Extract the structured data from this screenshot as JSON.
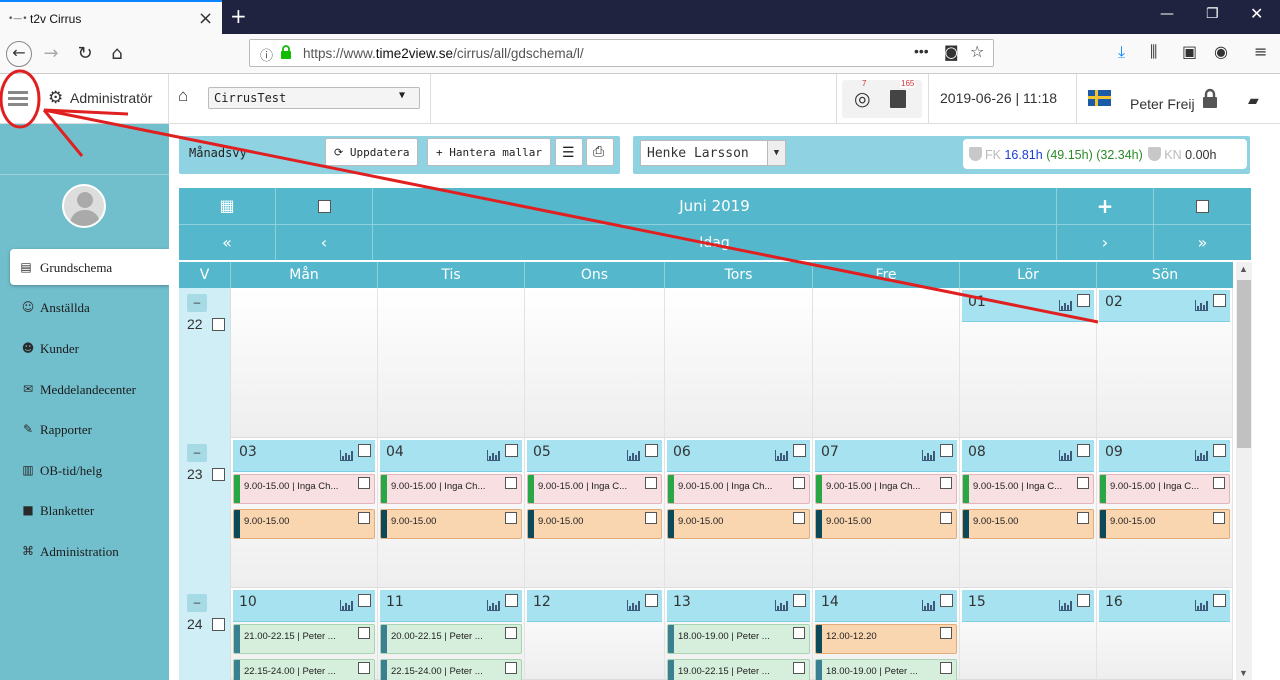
{
  "browser": {
    "tab_title": "t2v Cirrus",
    "favicon_text": "•—•",
    "url_host": "https://www.",
    "url_domain": "time2view.se",
    "url_path": "/cirrus/all/gdschema/l/"
  },
  "header": {
    "role_label": "Administratör",
    "customer_select": "CirrusTest",
    "badge_left": "7",
    "badge_right": "165",
    "datetime": "2019-06-26 | 11:18",
    "user_name": "Peter Freij"
  },
  "sidebar": {
    "items": [
      {
        "label": "Grundschema",
        "icon": "calendar-icon",
        "glyph": "▤"
      },
      {
        "label": "Anställda",
        "icon": "users-icon",
        "glyph": "☺"
      },
      {
        "label": "Kunder",
        "icon": "user-icon",
        "glyph": "☻"
      },
      {
        "label": "Meddelandecenter",
        "icon": "envelope-icon",
        "glyph": "✉"
      },
      {
        "label": "Rapporter",
        "icon": "pencil-icon",
        "glyph": "✎"
      },
      {
        "label": "OB-tid/helg",
        "icon": "chart-icon",
        "glyph": "▥"
      },
      {
        "label": "Blanketter",
        "icon": "file-icon",
        "glyph": "■"
      },
      {
        "label": "Administration",
        "icon": "key-icon",
        "glyph": "⌘"
      }
    ]
  },
  "toolbar": {
    "view_label": "Månadsvy",
    "refresh_label": "Uppdatera",
    "templates_label": "Hantera mallar"
  },
  "employee": {
    "selected": "Henke Larsson"
  },
  "hours": {
    "fk_label": "FK",
    "fk_value": "16.81h",
    "fk_extra1": "(49.15h)",
    "fk_extra2": "(32.34h)",
    "kn_label": "KN",
    "kn_value": "0.00h"
  },
  "calendar": {
    "month_title": "Juni 2019",
    "today_label": "Idag",
    "week_col": "V",
    "days": [
      "Mån",
      "Tis",
      "Ons",
      "Tors",
      "Fre",
      "Lör",
      "Sön"
    ],
    "weeks": [
      {
        "week": "22",
        "dates": [
          "",
          "",
          "",
          "",
          "",
          "01",
          "02"
        ]
      },
      {
        "week": "23",
        "dates": [
          "03",
          "04",
          "05",
          "06",
          "07",
          "08",
          "09"
        ]
      },
      {
        "week": "24",
        "dates": [
          "10",
          "11",
          "12",
          "13",
          "14",
          "15",
          "16"
        ]
      }
    ],
    "events_week23_row1": [
      "9.00-15.00 | Inga Ch...",
      "9.00-15.00 | Inga Ch...",
      "9.00-15.00 | Inga C...",
      "9.00-15.00 | Inga Ch...",
      "9.00-15.00 | Inga Ch...",
      "9.00-15.00 | Inga C...",
      "9.00-15.00 | Inga C..."
    ],
    "events_week23_row2": [
      "9.00-15.00",
      "9.00-15.00",
      "9.00-15.00",
      "9.00-15.00",
      "9.00-15.00",
      "9.00-15.00",
      "9.00-15.00"
    ],
    "events_week24_row1": [
      "21.00-22.15 | Peter ...",
      "20.00-22.15 | Peter ...",
      "",
      "18.00-19.00 | Peter ...",
      "12.00-12.20",
      "",
      ""
    ],
    "events_week24_row2": [
      "22.15-24.00 | Peter ...",
      "22.15-24.00 | Peter ...",
      "",
      "19.00-22.15 | Peter ...",
      "18.00-19.00 | Peter ...",
      "",
      ""
    ]
  },
  "colors": {
    "sidebar": "#71bfcc",
    "calendar_header": "#55b7cc",
    "annotation": "#e02020",
    "fk_blue": "#1a3fd6",
    "fk_green": "#2a8a2a"
  }
}
